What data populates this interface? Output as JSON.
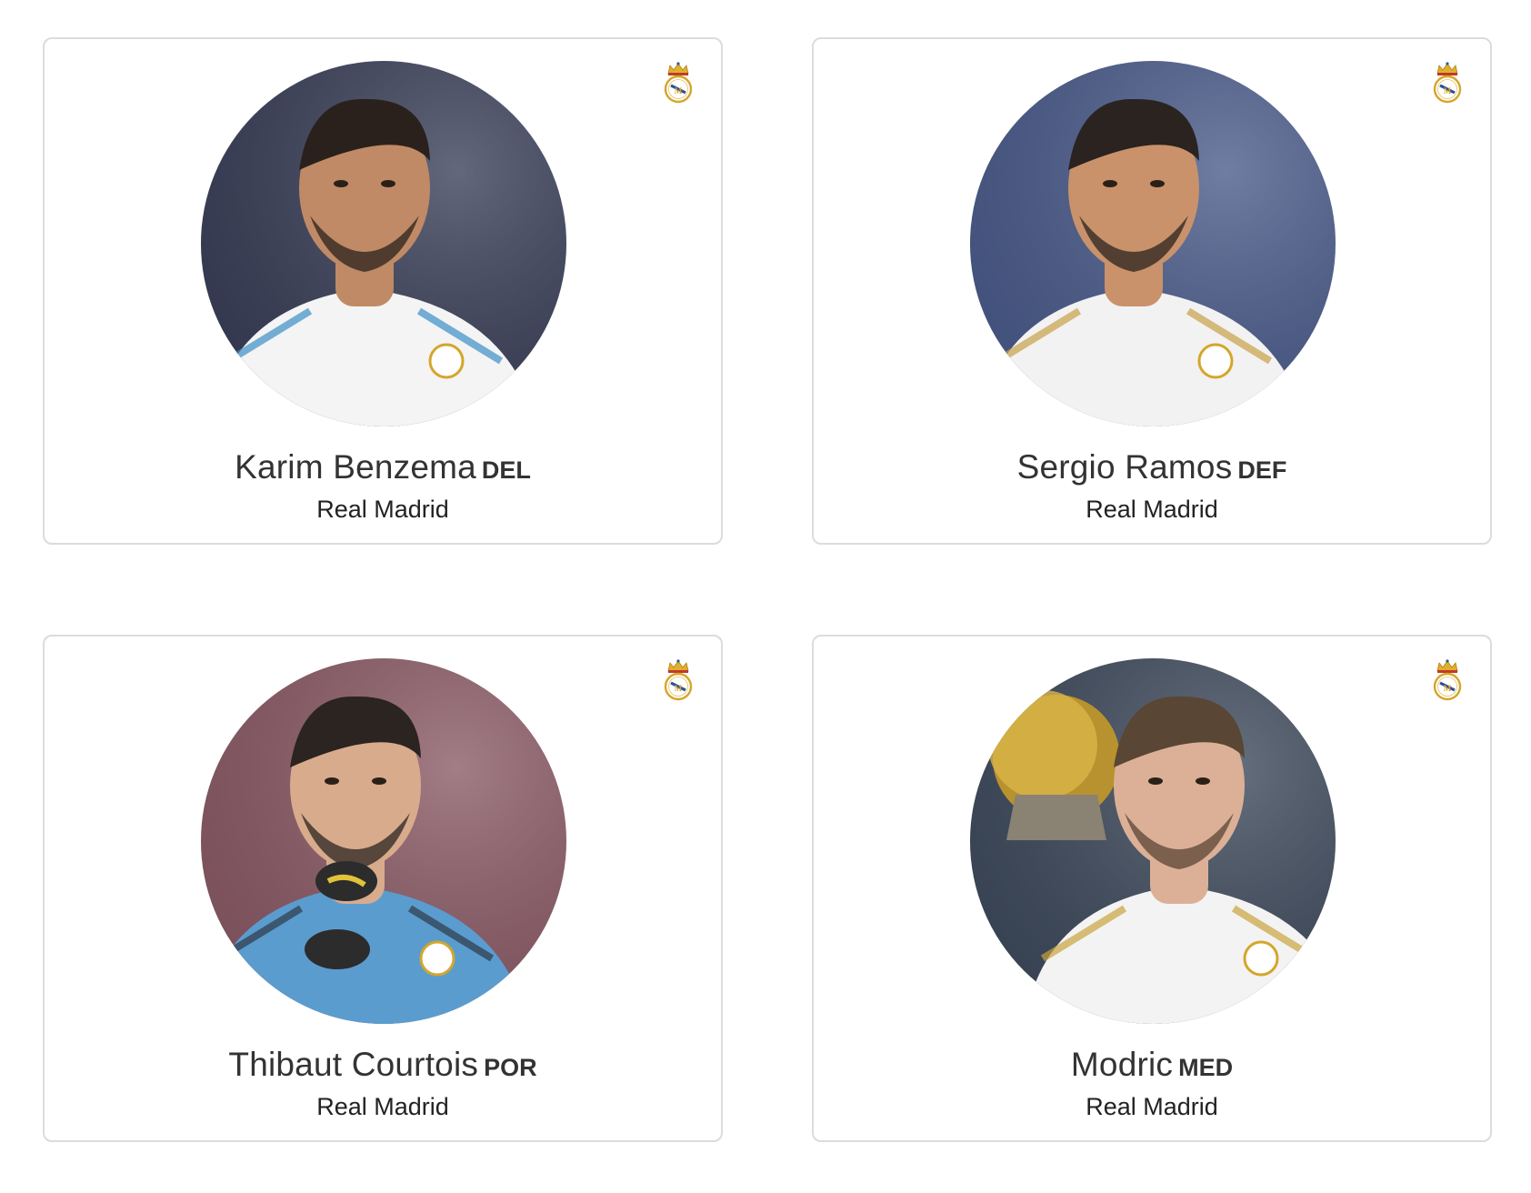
{
  "players": [
    {
      "name": "Karim Benzema",
      "position": "DEL",
      "team": "Real Madrid",
      "photo_icon": "player-photo-benzema",
      "crest_icon": "real-madrid-crest-icon",
      "colors": {
        "bg": "#3a3f58",
        "kit": "#f4f4f4",
        "accent": "#3d8fc7",
        "skin": "#c08a66",
        "hair": "#2a211c"
      }
    },
    {
      "name": "Sergio Ramos",
      "position": "DEF",
      "team": "Real Madrid",
      "photo_icon": "player-photo-ramos",
      "crest_icon": "real-madrid-crest-icon",
      "colors": {
        "bg": "#4a5b8a",
        "kit": "#f2f2f2",
        "accent": "#c8a24a",
        "skin": "#c9926b",
        "hair": "#2a231f"
      }
    },
    {
      "name": "Thibaut Courtois",
      "position": "POR",
      "team": "Real Madrid",
      "photo_icon": "player-photo-courtois",
      "crest_icon": "real-madrid-crest-icon",
      "colors": {
        "bg": "#8a5a66",
        "kit": "#5b9ccf",
        "accent": "#2f3a48",
        "skin": "#d8ab8d",
        "hair": "#2b2420"
      }
    },
    {
      "name": "Modric",
      "position": "MED",
      "team": "Real Madrid",
      "photo_icon": "player-photo-modric",
      "crest_icon": "real-madrid-crest-icon",
      "colors": {
        "bg": "#3e4a5c",
        "kit": "#f3f3f3",
        "accent": "#c9a43e",
        "skin": "#dcb097",
        "hair": "#5a4634"
      }
    }
  ]
}
